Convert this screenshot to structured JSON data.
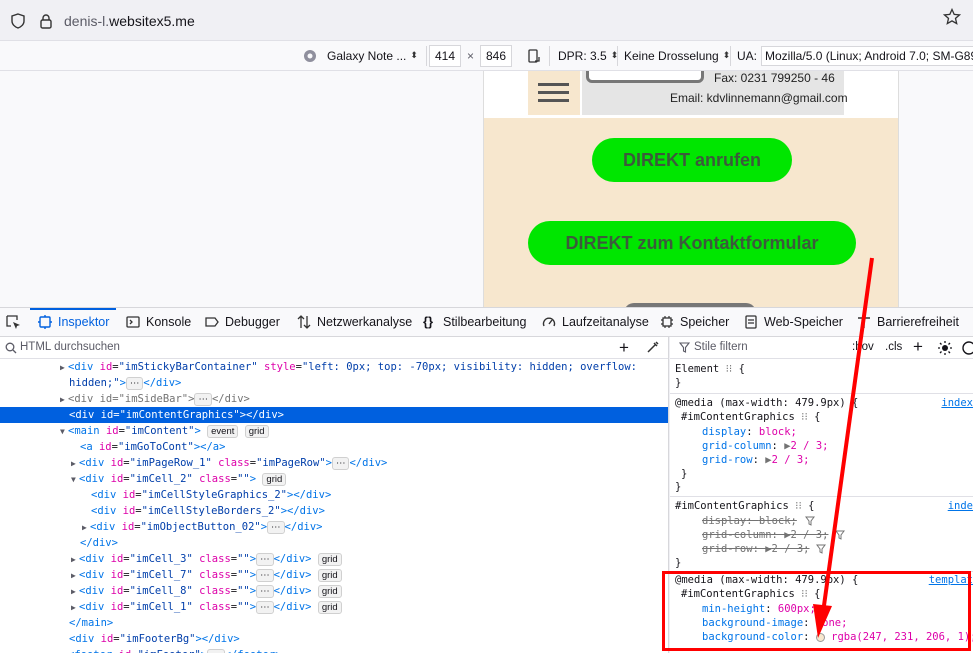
{
  "browser": {
    "url_prefix": "denis-l.",
    "url_domain": "websitex5.me"
  },
  "rdm_toolbar": {
    "device": "Galaxy Note ...",
    "width": "414",
    "times": "×",
    "height": "846",
    "dpr": "DPR: 3.5",
    "throttling": "Keine Drosselung",
    "ua_label": "UA:",
    "ua_value": "Mozilla/5.0 (Linux; Android 7.0; SM-G892A"
  },
  "page_preview": {
    "fax": "Fax:   0231 799250 - 46",
    "email": "Email: kdvlinnemann@gmail.com",
    "button_call": "DIREKT anrufen",
    "button_contact": "DIREKT zum Kontaktformular"
  },
  "devtools_tabs": [
    {
      "label": "Inspektor"
    },
    {
      "label": "Konsole"
    },
    {
      "label": "Debugger"
    },
    {
      "label": "Netzwerkanalyse"
    },
    {
      "label": "Stilbearbeitung"
    },
    {
      "label": "Laufzeitanalyse"
    },
    {
      "label": "Speicher"
    },
    {
      "label": "Web-Speicher"
    },
    {
      "label": "Barrierefreiheit"
    }
  ],
  "inspector": {
    "search_placeholder": "HTML durchsuchen",
    "html_lines": [
      {
        "tag": "<div",
        "attrs": " id=\"imStickyBarContainer\" style=\"left: 0px; top: -70px; visibility: hidden; overflow:",
        "rest": ""
      },
      {
        "text": "hidden;\">…</div>"
      },
      {
        "text": "<div id=\"imSideBar\">…</div>"
      },
      {
        "text": "<div id=\"imContentGraphics\"></div>"
      },
      {
        "text": "<main id=\"imContent\">"
      },
      {
        "text": "<a id=\"imGoToCont\"></a>"
      },
      {
        "text": "<div id=\"imPageRow_1\" class=\"imPageRow\">…</div>"
      },
      {
        "text": "<div id=\"imCell_2\" class=\"\">"
      },
      {
        "text": "<div id=\"imCellStyleGraphics_2\"></div>"
      },
      {
        "text": "<div id=\"imCellStyleBorders_2\"></div>"
      },
      {
        "text": "<div id=\"imObjectButton_02\">…</div>"
      },
      {
        "text": "</div>"
      },
      {
        "text": "<div id=\"imCell_3\" class=\"\">…</div>"
      },
      {
        "text": "<div id=\"imCell_7\" class=\"\">…</div>"
      },
      {
        "text": "<div id=\"imCell_8\" class=\"\">…</div>"
      },
      {
        "text": "<div id=\"imCell_1\" class=\"\">…</div>"
      },
      {
        "text": "</main>"
      },
      {
        "text": "<div id=\"imFooterBg\"></div>"
      },
      {
        "text": "<footer id=\"imFooter\">…</footer>"
      }
    ],
    "badges": {
      "event": "event",
      "grid": "grid"
    }
  },
  "rules": {
    "filter_placeholder": "Stile filtern",
    "hov": ":hov",
    "cls": ".cls",
    "element_label": "Element",
    "rule1_media": "@media (max-width: 479.9px) {",
    "rule1_selector": "#imContentGraphics",
    "rule1_link": "index",
    "rule1_props": [
      {
        "name": "display",
        "value": "block;"
      },
      {
        "name": "grid-column",
        "value": "2 / 3;"
      },
      {
        "name": "grid-row",
        "value": "2 / 3;"
      }
    ],
    "rule2_selector": "#imContentGraphics",
    "rule2_link": "inde",
    "rule2_props": [
      {
        "name": "display",
        "value": "block;"
      },
      {
        "name": "grid-column",
        "value": "2 / 3;"
      },
      {
        "name": "grid-row",
        "value": "2 / 3;"
      }
    ],
    "rule3_media": "@media (max-width: 479.9px) {",
    "rule3_selector": "#imContentGraphics",
    "rule3_link": "templat",
    "rule3_props": [
      {
        "name": "min-height",
        "value": "600px;"
      },
      {
        "name": "background-image",
        "value": "none;"
      },
      {
        "name": "background-color",
        "value": "rgba(247, 231, 206, 1);"
      }
    ]
  },
  "colors": {
    "swatch": "#f7e7ce",
    "annotation": "#ff0000",
    "accent": "#0060df",
    "green_button": "#00e600"
  }
}
